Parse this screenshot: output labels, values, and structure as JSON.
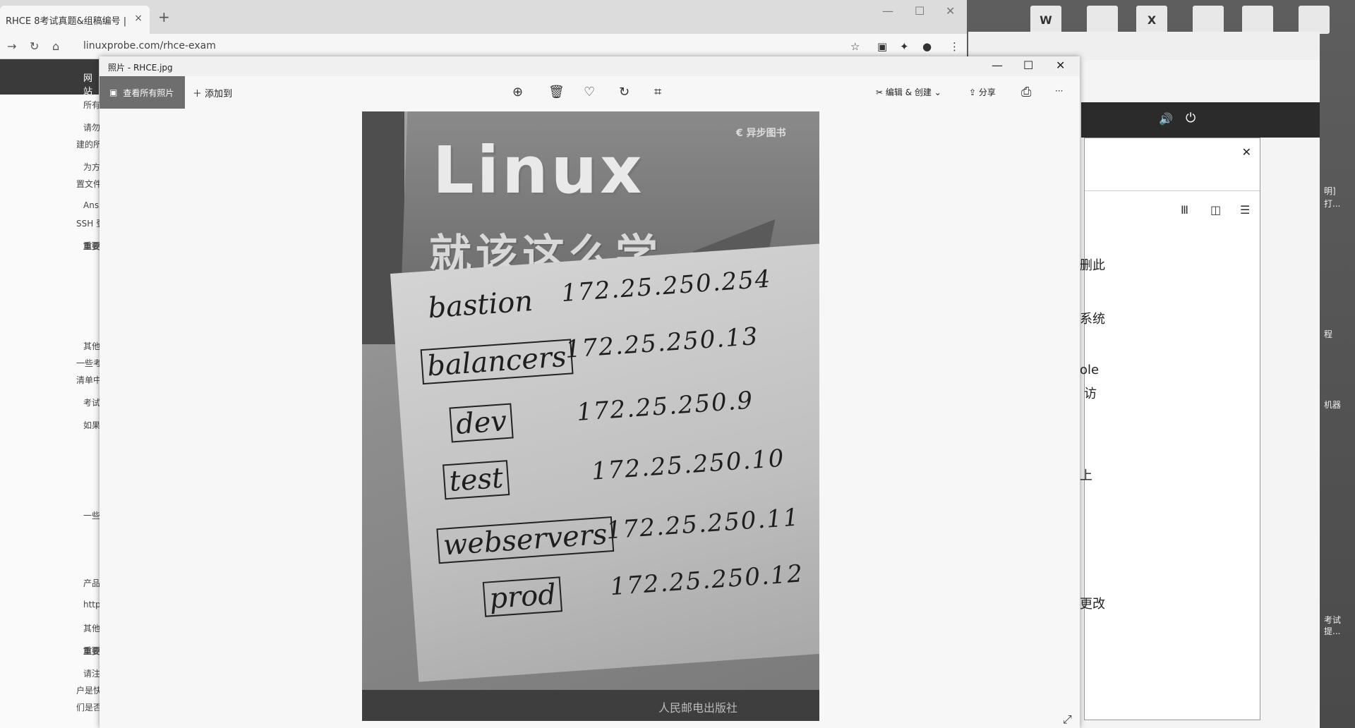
{
  "browser": {
    "tab_title": "RHCE 8考试真题&组稿编号 | ",
    "tab_close": "×",
    "new_tab": "+",
    "url": "linuxprobe.com/rhce-exam",
    "sidebar_header": "网站",
    "left_snippets": [
      "所有",
      "请勿",
      "建的所",
      "为方",
      "置文件",
      "Ans",
      "SSH 登",
      "重要",
      "其他",
      "一些考",
      "清单中",
      "考试",
      "如果",
      "一些",
      "产品",
      "http",
      "其他",
      "重要",
      "请注",
      "户是快",
      "们是否"
    ]
  },
  "right_window": {
    "texts": [
      "删此",
      "系统",
      "ole",
      "访",
      "上",
      "更改"
    ]
  },
  "desktop": {
    "labels": [
      "明]",
      "打...",
      "程",
      "机器",
      "考试",
      "提..."
    ],
    "icon_word": "W",
    "icon_excel": "X"
  },
  "photos": {
    "title": "照片 - RHCE.jpg",
    "view_all": "查看所有照片",
    "add_to": "添加到",
    "edit_create": "编辑 & 创建",
    "share": "分享",
    "more": "···",
    "minimize": "—",
    "maximize": "☐",
    "close": "✕"
  },
  "image": {
    "book_title": "Linux",
    "book_subtitle": "就该这么学",
    "publisher_logo": "€ 异步图书",
    "bottom_text": "人民邮电出版社",
    "hosts": [
      {
        "name": "bastion",
        "ip": "172.25.250.254"
      },
      {
        "name": "balancers",
        "ip": "172.25.250.13"
      },
      {
        "name": "dev",
        "ip": "172.25.250.9"
      },
      {
        "name": "test",
        "ip": "172.25.250.10"
      },
      {
        "name": "webservers",
        "ip": "172.25.250.11"
      },
      {
        "name": "prod",
        "ip": "172.25.250.12"
      }
    ]
  }
}
